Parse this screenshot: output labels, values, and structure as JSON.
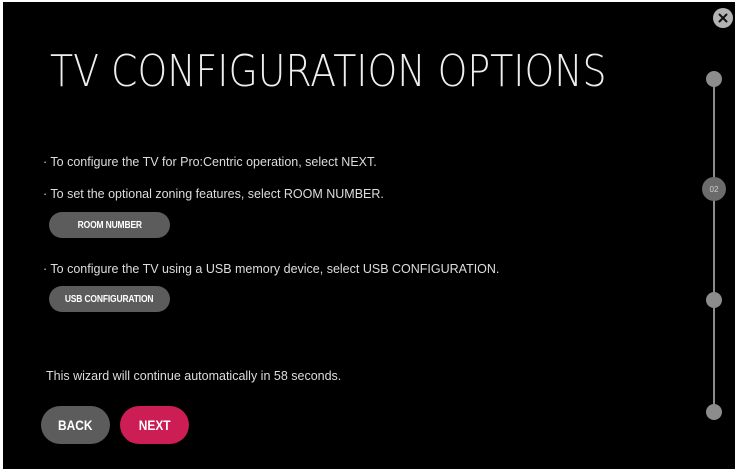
{
  "title": "TV CONFIGURATION OPTIONS",
  "instructions": {
    "pro_centric": "· To configure the TV for Pro:Centric operation, select NEXT.",
    "zoning": "· To set the optional zoning features, select ROOM NUMBER.",
    "usb": "· To configure the TV using a USB memory device, select USB CONFIGURATION."
  },
  "buttons": {
    "room_number": "ROOM NUMBER",
    "usb_configuration": "USB CONFIGURATION",
    "back": "BACK",
    "next": "NEXT"
  },
  "countdown_text": "This wizard will continue automatically in 58 seconds.",
  "progress": {
    "current_step_label": "02"
  },
  "icons": {
    "close": "close-icon"
  },
  "colors": {
    "background": "#000000",
    "accent": "#cc1d54",
    "button_gray": "#5c5c5c"
  }
}
